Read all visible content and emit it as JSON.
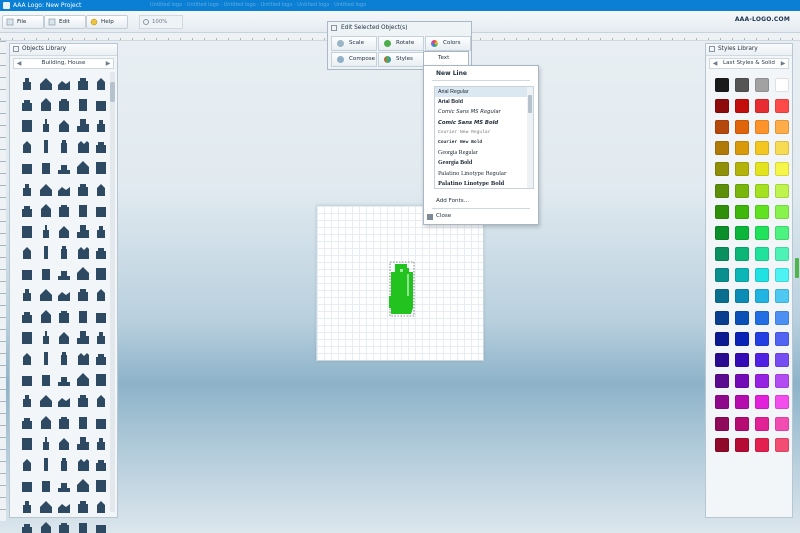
{
  "window": {
    "title": "AAA Logo: New Project",
    "faded_tabs": "Untitled logo  ·  Untitled logo  ·  Untitled logo  ·  Untitled logo  ·  Untitled logo  ·  Untitled logo"
  },
  "menu": {
    "file": "File",
    "edit": "Edit",
    "help": "Help",
    "zoom": "100%",
    "brand": "AAA-LOGO.COM"
  },
  "objects_library": {
    "title": "Objects Library",
    "category": "Building, House",
    "prev_icon": "chevron-left-icon",
    "next_icon": "chevron-right-icon",
    "icon_count": 110
  },
  "styles_library": {
    "title": "Styles Library",
    "category": "Last Styles & Solid",
    "colors": [
      "#1b1b1b",
      "#555555",
      "#9a9a9a",
      "#ffffff",
      "#8e0b0b",
      "#c40d0d",
      "#e51c22",
      "#ff3b3b",
      "#b5480c",
      "#e0640a",
      "#ff8a1a",
      "#ffa53a",
      "#b07a08",
      "#d99a0a",
      "#f2c20f",
      "#f6d845",
      "#8f8f0a",
      "#b3b30b",
      "#e1e10e",
      "#f4f43b",
      "#5d8f0a",
      "#79b60b",
      "#9ce00f",
      "#baf23f",
      "#2f8f0a",
      "#3fb60b",
      "#55e00f",
      "#80f23f",
      "#0a8f2b",
      "#0bb63a",
      "#0fe04e",
      "#3ff277",
      "#0a8f5e",
      "#0bb677",
      "#0fe094",
      "#3ff2b0",
      "#0a8f8f",
      "#0bb6b6",
      "#0fe0e0",
      "#3ff2f2",
      "#0a6f8f",
      "#0b8cb6",
      "#0fade0",
      "#3fc5f2",
      "#0a3f8f",
      "#0b50b6",
      "#0f64e0",
      "#3f87f2",
      "#0a1a8f",
      "#0b22b6",
      "#1030e0",
      "#4357f2",
      "#2a0a8f",
      "#350bb6",
      "#430fe0",
      "#6b3ff2",
      "#5a0a8f",
      "#720bb6",
      "#8e0fe0",
      "#ad3ff2",
      "#8f0a8a",
      "#b60baf",
      "#e00fd8",
      "#f23fec",
      "#8f0a5a",
      "#b60b72",
      "#e00f8f",
      "#f23fad",
      "#8f0a2a",
      "#b60b35",
      "#e00f43",
      "#f23f68"
    ]
  },
  "edit_panel": {
    "title": "Edit Selected Object(s)",
    "buttons": {
      "scale": "Scale",
      "rotate": "Rotate",
      "colors": "Colors",
      "compose": "Compose",
      "styles": "Styles",
      "text": "Text"
    }
  },
  "text_menu": {
    "new_line": "New Line",
    "fonts": [
      "Arial Regular",
      "Arial Bold",
      "Comic Sans MS Regular",
      "Comic Sans MS Bold",
      "Courier New Regular",
      "Courier New Bold",
      "Georgia Regular",
      "Georgia Bold",
      "Palatino Linotype Regular",
      "Palatino Linotype Bold"
    ],
    "add_fonts": "Add Fonts...",
    "close": "Close"
  },
  "canvas": {
    "selected_object": "building",
    "selected_color": "#22c21f"
  }
}
